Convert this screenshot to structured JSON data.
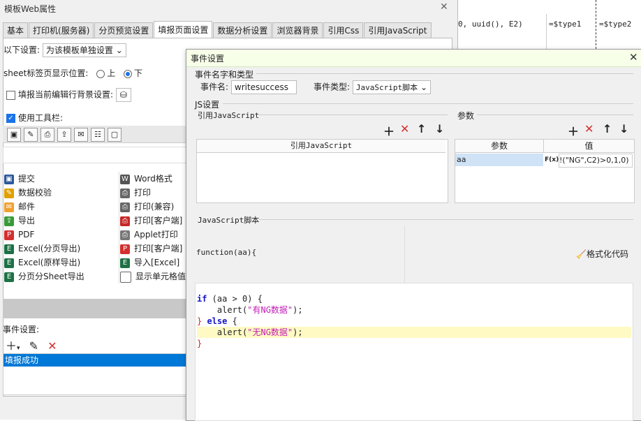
{
  "background_sheet": {
    "cells": [
      "0, uuid(), E2)",
      "=$type1",
      "=$type2"
    ]
  },
  "main_window": {
    "title": "模板Web属性",
    "close_icon": "close-icon",
    "tabs": [
      "基本",
      "打印机(服务器)",
      "分页预览设置",
      "填报页面设置",
      "数据分析设置",
      "浏览器背景",
      "引用Css",
      "引用JavaScript"
    ],
    "active_tab": "填报页面设置",
    "settings_label": "以下设置:",
    "settings_select": "为该模板单独设置",
    "sheet_pos_label": "sheet标签页显示位置:",
    "sheet_pos_up": "上",
    "sheet_pos_down": "下",
    "row_bg_label": "填报当前编辑行背景设置:",
    "use_toolbar_label": "使用工具栏:",
    "buttons_left": [
      "提交",
      "数据校验",
      "邮件",
      "导出",
      "PDF",
      "Excel(分页导出)",
      "Excel(原样导出)",
      "分页分Sheet导出"
    ],
    "buttons_right": [
      "Word格式",
      "打印",
      "打印(兼容)",
      "打印[客户端]",
      "Applet打印",
      "打印[客户端]",
      "导入[Excel]",
      "显示单元格值"
    ],
    "event_label": "事件设置:",
    "event_items": [
      "填报成功"
    ]
  },
  "dialog": {
    "title": "事件设置",
    "name_type_group": "事件名字和类型",
    "event_name_label": "事件名:",
    "event_name_value": "writesuccess",
    "event_type_label": "事件类型:",
    "event_type_value": "JavaScript脚本",
    "js_group": "JS设置",
    "ref_js_label": "引用JavaScript",
    "ref_js_header": "引用JavaScript",
    "params_label": "参数",
    "params_header_name": "参数",
    "params_header_value": "值",
    "param_name": "aa",
    "param_value": "!(\"NG\",C2)>0,1,0)",
    "fx_label": "F(x)",
    "script_label": "JavaScript脚本",
    "function_sig": "function(aa){",
    "format_code": "格式化代码",
    "code": {
      "l1_kw": "if",
      "l1_rest": " (aa > 0) {",
      "l2_fn": "    alert(",
      "l2_str": "\"有NG数据\"",
      "l2_end": ");",
      "l3_a": "} ",
      "l3_kw": "else",
      "l3_b": " {",
      "l4_fn": "    alert(",
      "l4_str": "\"无NG数据\"",
      "l4_end": ");",
      "l5": "}"
    }
  }
}
